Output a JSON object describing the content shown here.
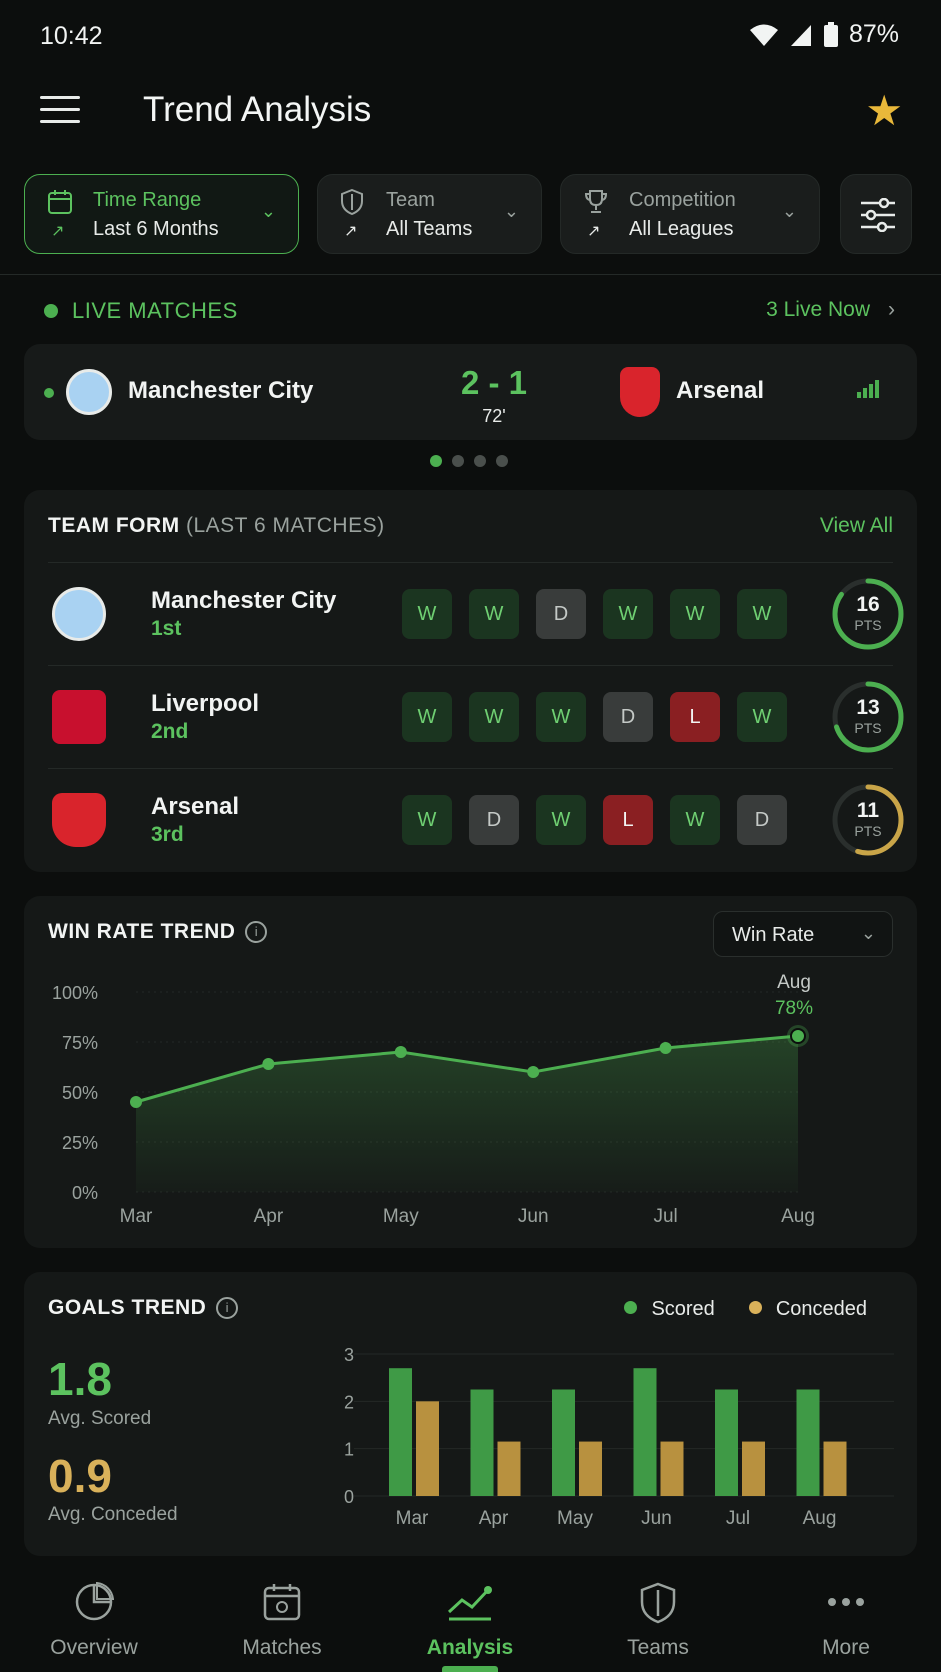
{
  "status": {
    "time": "10:42",
    "battery": "87%"
  },
  "appbar": {
    "title": "Trend Analysis"
  },
  "filters": [
    {
      "label": "Time Range",
      "value": "Last 6 Months",
      "icon": "calendar-icon",
      "active": true
    },
    {
      "label": "Team",
      "value": "All Teams",
      "icon": "shield-icon",
      "active": false
    },
    {
      "label": "Competition",
      "value": "All Leagues",
      "icon": "trophy-icon",
      "active": false
    }
  ],
  "live": {
    "label": "LIVE MATCHES",
    "count": "3 Live Now",
    "match": {
      "home": "Manchester City",
      "away": "Arsenal",
      "score": "2 - 1",
      "minute": "72'"
    }
  },
  "form": {
    "title": "TEAM FORM",
    "subtitle": "(LAST 6 MATCHES)",
    "view_all": "View All",
    "teams": [
      {
        "name": "Manchester City",
        "pos": "1st",
        "results": [
          "W",
          "W",
          "D",
          "W",
          "W",
          "W"
        ],
        "pts": "16",
        "pts_unit": "PTS",
        "ring_fraction": 0.85,
        "ring_color": "#4caf50"
      },
      {
        "name": "Liverpool",
        "pos": "2nd",
        "results": [
          "W",
          "W",
          "W",
          "D",
          "L",
          "W"
        ],
        "pts": "13",
        "pts_unit": "PTS",
        "ring_fraction": 0.7,
        "ring_color": "#4caf50"
      },
      {
        "name": "Arsenal",
        "pos": "3rd",
        "results": [
          "W",
          "D",
          "W",
          "L",
          "W",
          "D"
        ],
        "pts": "11",
        "pts_unit": "PTS",
        "ring_fraction": 0.55,
        "ring_color": "#c9a548"
      }
    ]
  },
  "win": {
    "title": "WIN RATE TREND",
    "dropdown": "Win Rate",
    "highlight_month": "Aug",
    "highlight_value": "78%"
  },
  "goals": {
    "title": "GOALS TREND",
    "avg_scored": "1.8",
    "avg_scored_label": "Avg. Scored",
    "avg_conceded": "0.9",
    "avg_conceded_label": "Avg. Conceded",
    "legend_scored": "Scored",
    "legend_conceded": "Conceded"
  },
  "chart_data": [
    {
      "type": "area",
      "categories": [
        "Mar",
        "Apr",
        "May",
        "Jun",
        "Jul",
        "Aug"
      ],
      "values": [
        45,
        64,
        70,
        60,
        72,
        78
      ],
      "ylim": [
        0,
        100
      ],
      "yticks": [
        "0%",
        "25%",
        "50%",
        "75%",
        "100%"
      ],
      "grid": true,
      "color": "#4caf50"
    },
    {
      "type": "bar",
      "categories": [
        "Mar",
        "Apr",
        "May",
        "Jun",
        "Jul",
        "Aug"
      ],
      "series": [
        {
          "name": "Scored",
          "values": [
            2.7,
            2.25,
            2.25,
            2.7,
            2.25,
            2.25
          ],
          "color": "#3f9a46"
        },
        {
          "name": "Conceded",
          "values": [
            2.0,
            1.15,
            1.15,
            1.15,
            1.15,
            1.15
          ],
          "color": "#b8913f"
        }
      ],
      "ylim": [
        0,
        3
      ],
      "yticks": [
        "0",
        "1",
        "2",
        "3"
      ],
      "grid": true
    }
  ],
  "nav": [
    {
      "label": "Overview",
      "icon": "pie-chart-icon",
      "active": false
    },
    {
      "label": "Matches",
      "icon": "calendar-icon",
      "active": false
    },
    {
      "label": "Analysis",
      "icon": "trend-icon",
      "active": true
    },
    {
      "label": "Teams",
      "icon": "shield-icon",
      "active": false
    },
    {
      "label": "More",
      "icon": "more-icon",
      "active": false
    }
  ]
}
